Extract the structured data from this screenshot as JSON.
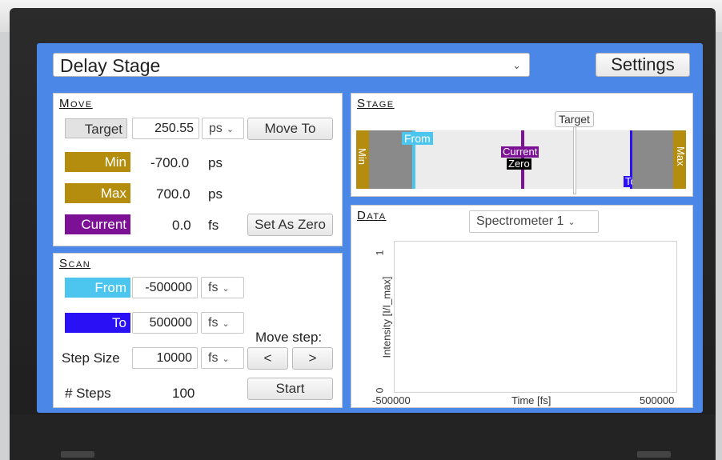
{
  "header": {
    "stage_select": "Delay Stage",
    "settings_label": "Settings"
  },
  "move": {
    "title": "Move",
    "target_label": "Target",
    "target_value": "250.55",
    "target_unit": "ps",
    "move_to_label": "Move To",
    "min_label": "Min",
    "min_value": "-700.0",
    "min_unit": "ps",
    "max_label": "Max",
    "max_value": "700.0",
    "max_unit": "ps",
    "current_label": "Current",
    "current_value": "0.0",
    "current_unit": "fs",
    "set_zero_label": "Set As Zero"
  },
  "scan": {
    "title": "Scan",
    "from_label": "From",
    "from_value": "-500000",
    "from_unit": "fs",
    "to_label": "To",
    "to_value": "500000",
    "to_unit": "fs",
    "move_step_label": "Move step:",
    "step_back_label": "<",
    "step_fwd_label": ">",
    "step_size_label": "Step Size",
    "step_size_value": "10000",
    "step_size_unit": "fs",
    "steps_label": "# Steps",
    "steps_value": "100",
    "start_label": "Start"
  },
  "stage": {
    "title": "Stage",
    "target_tag": "Target",
    "min_tag": "Min",
    "max_tag": "Max",
    "from_tag": "From",
    "current_tag": "Current",
    "zero_tag": "Zero",
    "to_tag": "To"
  },
  "data_panel": {
    "title": "Data",
    "source_select": "Spectrometer 1",
    "y_tick_top": "1",
    "y_tick_bottom": "0",
    "ylabel": "Intensity [I/I_max]",
    "xlabel": "Time [fs]",
    "x_tick_left": "-500000",
    "x_tick_right": "500000"
  },
  "colors": {
    "gold": "#b58d0e",
    "purple": "#7c1196",
    "from_blue": "#4cc6ef",
    "to_blue": "#2a11f5",
    "screen_blue": "#4a87e6"
  }
}
